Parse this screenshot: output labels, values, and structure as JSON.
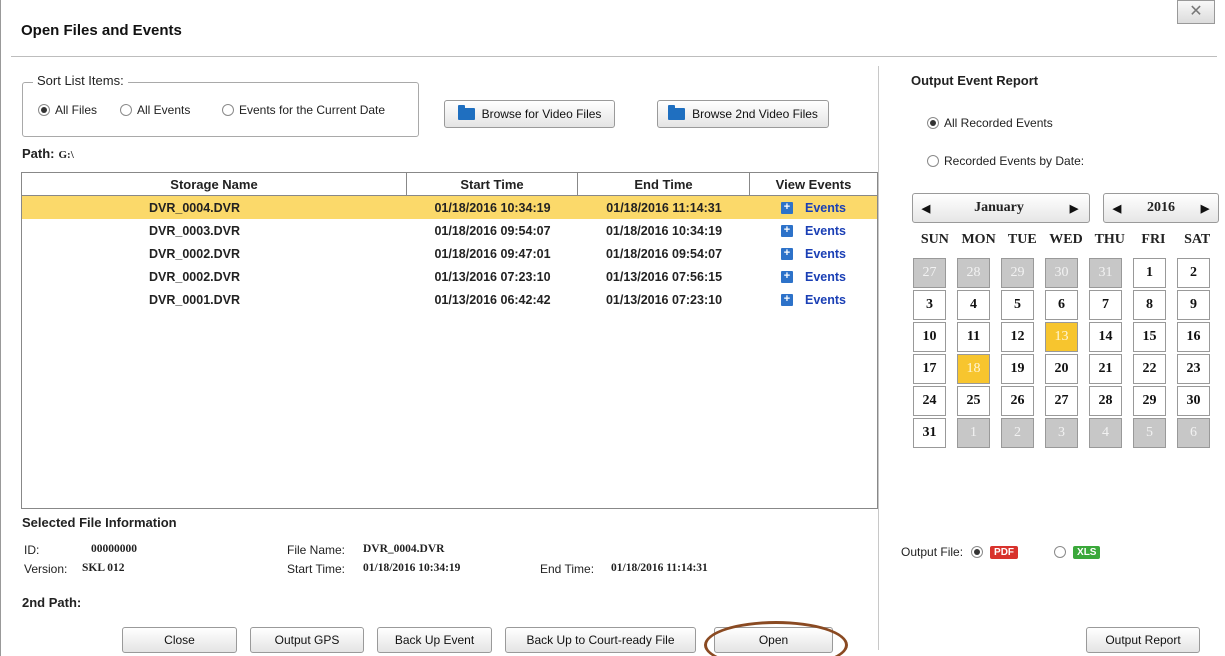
{
  "window": {
    "title": "Open Files and Events",
    "close_glyph": "✕"
  },
  "sort": {
    "legend": "Sort List Items:",
    "options": [
      "All Files",
      "All Events",
      "Events for the Current Date"
    ],
    "selected": "All Files"
  },
  "browse": {
    "video_label": "Browse for Video Files",
    "video2_label": "Browse 2nd Video Files"
  },
  "path": {
    "label": "Path:",
    "value": "G:\\"
  },
  "table": {
    "headers": [
      "Storage Name",
      "Start Time",
      "End Time",
      "View Events"
    ],
    "rows": [
      {
        "name": "DVR_0004.DVR",
        "start": "01/18/2016 10:34:19",
        "end": "01/18/2016 11:14:31",
        "events": "Events",
        "selected": true
      },
      {
        "name": "DVR_0003.DVR",
        "start": "01/18/2016 09:54:07",
        "end": "01/18/2016 10:34:19",
        "events": "Events"
      },
      {
        "name": "DVR_0002.DVR",
        "start": "01/18/2016 09:47:01",
        "end": "01/18/2016 09:54:07",
        "events": "Events"
      },
      {
        "name": "DVR_0002.DVR",
        "start": "01/13/2016 07:23:10",
        "end": "01/13/2016 07:56:15",
        "events": "Events"
      },
      {
        "name": "DVR_0001.DVR",
        "start": "01/13/2016 06:42:42",
        "end": "01/13/2016 07:23:10",
        "events": "Events"
      }
    ],
    "expand_glyph": "+"
  },
  "file_info": {
    "title": "Selected File Information",
    "id_label": "ID:",
    "id_value": "00000000",
    "version_label": "Version:",
    "version_value": "SKL 012",
    "filename_label": "File Name:",
    "filename_value": "DVR_0004.DVR",
    "start_label": "Start Time:",
    "start_value": "01/18/2016 10:34:19",
    "end_label": "End Time:",
    "end_value": "01/18/2016 11:14:31",
    "second_path_label": "2nd Path:"
  },
  "buttons": {
    "close": "Close",
    "output_gps": "Output GPS",
    "backup_event": "Back Up Event",
    "backup_court": "Back Up to Court-ready File",
    "open": "Open",
    "output_report": "Output Report"
  },
  "report": {
    "title": "Output Event Report",
    "options": [
      "All Recorded Events",
      "Recorded Events by Date:"
    ],
    "selected": "All Recorded Events",
    "output_file_label": "Output File:",
    "output_formats": [
      "PDF",
      "XLS"
    ],
    "selected_format": "PDF"
  },
  "calendar": {
    "month": "January",
    "year": "2016",
    "prev_glyph": "◀",
    "next_glyph": "▶",
    "weekdays": [
      "SUN",
      "MON",
      "TUE",
      "WED",
      "THU",
      "FRI",
      "SAT"
    ],
    "days": [
      {
        "d": "27",
        "t": "other"
      },
      {
        "d": "28",
        "t": "other"
      },
      {
        "d": "29",
        "t": "other"
      },
      {
        "d": "30",
        "t": "other"
      },
      {
        "d": "31",
        "t": "other"
      },
      {
        "d": "1",
        "t": "cur"
      },
      {
        "d": "2",
        "t": "cur"
      },
      {
        "d": "3",
        "t": "cur"
      },
      {
        "d": "4",
        "t": "cur"
      },
      {
        "d": "5",
        "t": "cur"
      },
      {
        "d": "6",
        "t": "cur"
      },
      {
        "d": "7",
        "t": "cur"
      },
      {
        "d": "8",
        "t": "cur"
      },
      {
        "d": "9",
        "t": "cur"
      },
      {
        "d": "10",
        "t": "cur"
      },
      {
        "d": "11",
        "t": "cur"
      },
      {
        "d": "12",
        "t": "cur"
      },
      {
        "d": "13",
        "t": "event"
      },
      {
        "d": "14",
        "t": "cur"
      },
      {
        "d": "15",
        "t": "cur"
      },
      {
        "d": "16",
        "t": "cur"
      },
      {
        "d": "17",
        "t": "cur"
      },
      {
        "d": "18",
        "t": "event"
      },
      {
        "d": "19",
        "t": "cur"
      },
      {
        "d": "20",
        "t": "cur"
      },
      {
        "d": "21",
        "t": "cur"
      },
      {
        "d": "22",
        "t": "cur"
      },
      {
        "d": "23",
        "t": "cur"
      },
      {
        "d": "24",
        "t": "cur"
      },
      {
        "d": "25",
        "t": "cur"
      },
      {
        "d": "26",
        "t": "cur"
      },
      {
        "d": "27",
        "t": "cur"
      },
      {
        "d": "28",
        "t": "cur"
      },
      {
        "d": "29",
        "t": "cur"
      },
      {
        "d": "30",
        "t": "cur"
      },
      {
        "d": "31",
        "t": "cur"
      },
      {
        "d": "1",
        "t": "other"
      },
      {
        "d": "2",
        "t": "other"
      },
      {
        "d": "3",
        "t": "other"
      },
      {
        "d": "4",
        "t": "other"
      },
      {
        "d": "5",
        "t": "other"
      },
      {
        "d": "6",
        "t": "other"
      }
    ]
  },
  "colors": {
    "selected_row": "#fbd96a",
    "event_day": "#f7c52e",
    "link": "#1a3fb5",
    "highlight_ring": "#8a4a22"
  }
}
